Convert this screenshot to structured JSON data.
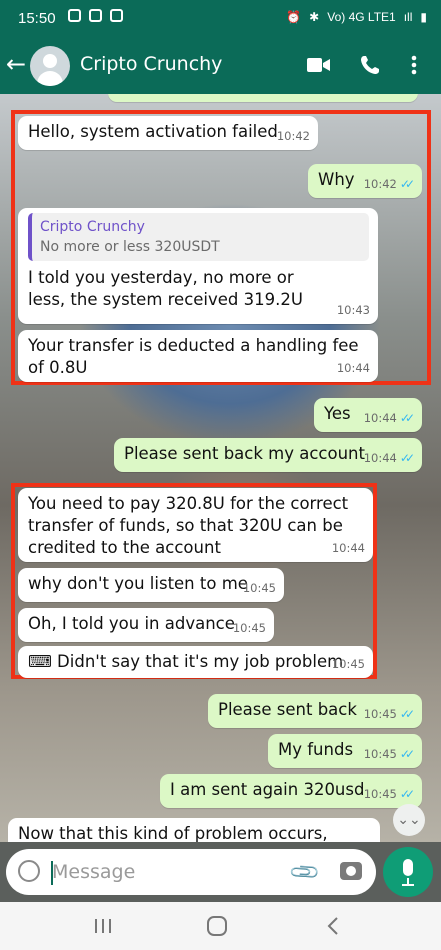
{
  "status_bar": {
    "time": "15:50",
    "network": "Vo) 4G LTE1",
    "signal": "ıll"
  },
  "header": {
    "contact_name": "Cripto Crunchy"
  },
  "messages": [
    {
      "text": "Hello, system activation failed",
      "time": "10:42",
      "direction": "in"
    },
    {
      "text": "Why",
      "time": "10:42",
      "direction": "out",
      "status": "read"
    },
    {
      "quote_name": "Cripto Crunchy",
      "quote_text": "No more or less 320USDT",
      "text": "I told you yesterday, no more or less, the system received 319.2U",
      "time": "10:43",
      "direction": "in"
    },
    {
      "text": "Your transfer is deducted a handling fee of 0.8U",
      "time": "10:44",
      "direction": "in"
    },
    {
      "text": "Yes",
      "time": "10:44",
      "direction": "out",
      "status": "read"
    },
    {
      "text": "Please sent back my account",
      "time": "10:44",
      "direction": "out",
      "status": "read"
    },
    {
      "text": "You need to pay 320.8U for the correct transfer of funds, so that 320U can be credited to the account",
      "time": "10:44",
      "direction": "in"
    },
    {
      "text": "why don't you listen to me",
      "time": "10:45",
      "direction": "in"
    },
    {
      "text": "Oh, I told you in advance",
      "time": "10:45",
      "direction": "in"
    },
    {
      "text": "⌨ Didn't say that it's my job problem",
      "time": "10:45",
      "direction": "in"
    },
    {
      "text": "Please sent back",
      "time": "10:45",
      "direction": "out",
      "status": "read"
    },
    {
      "text": "My funds",
      "time": "10:45",
      "direction": "out",
      "status": "read"
    },
    {
      "text": "I am sent again 320usd",
      "time": "10:45",
      "direction": "out",
      "status": "read"
    },
    {
      "text": "Now that this kind of problem occurs,",
      "direction": "in"
    }
  ],
  "input": {
    "placeholder": "Message"
  },
  "colors": {
    "header": "#0b6b58",
    "outgoing_bubble": "#dcf8c6",
    "incoming_bubble": "#ffffff",
    "highlight_box": "#ef3217",
    "read_ticks": "#34b7f1",
    "mic_button": "#0f9d76"
  },
  "icons": [
    "back-arrow-icon",
    "video-call-icon",
    "voice-call-icon",
    "more-options-icon",
    "emoji-icon",
    "attach-icon",
    "camera-icon",
    "mic-icon",
    "scroll-down-icon"
  ]
}
